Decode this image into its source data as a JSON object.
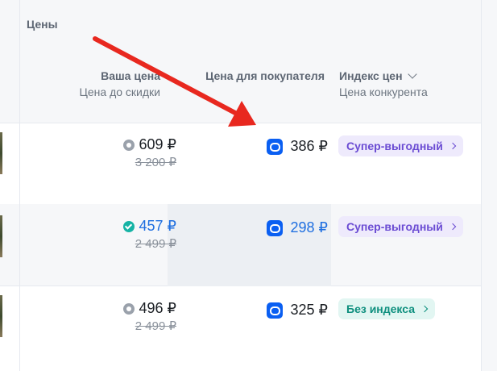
{
  "header": {
    "group_title": "Цены",
    "columns": [
      {
        "title": "Ваша цена",
        "subtitle": "Цена до скидки"
      },
      {
        "title": "Цена для покупателя",
        "subtitle": ""
      },
      {
        "title": "Индекс цен",
        "subtitle": "Цена конкурента"
      }
    ]
  },
  "rows": [
    {
      "price": "609 ₽",
      "old_price": "3 200 ₽",
      "buyer_price": "386 ₽",
      "index": "Супер-выгодный",
      "price_badge": "grey-icon",
      "index_style": "violet"
    },
    {
      "price": "457 ₽",
      "old_price": "2 499 ₽",
      "buyer_price": "298 ₽",
      "index": "Супер-выгодный",
      "price_badge": "teal-check-icon",
      "index_style": "violet"
    },
    {
      "price": "496 ₽",
      "old_price": "2 499 ₽",
      "buyer_price": "325 ₽",
      "index": "Без индекса",
      "price_badge": "grey-icon",
      "index_style": "green"
    }
  ],
  "colors": {
    "accent_blue": "#1f6fe0",
    "wallet_blue": "#0a5ff2",
    "violet": "#6a4bd3",
    "green": "#0e8f7e",
    "arrow_red": "#e8281f"
  }
}
